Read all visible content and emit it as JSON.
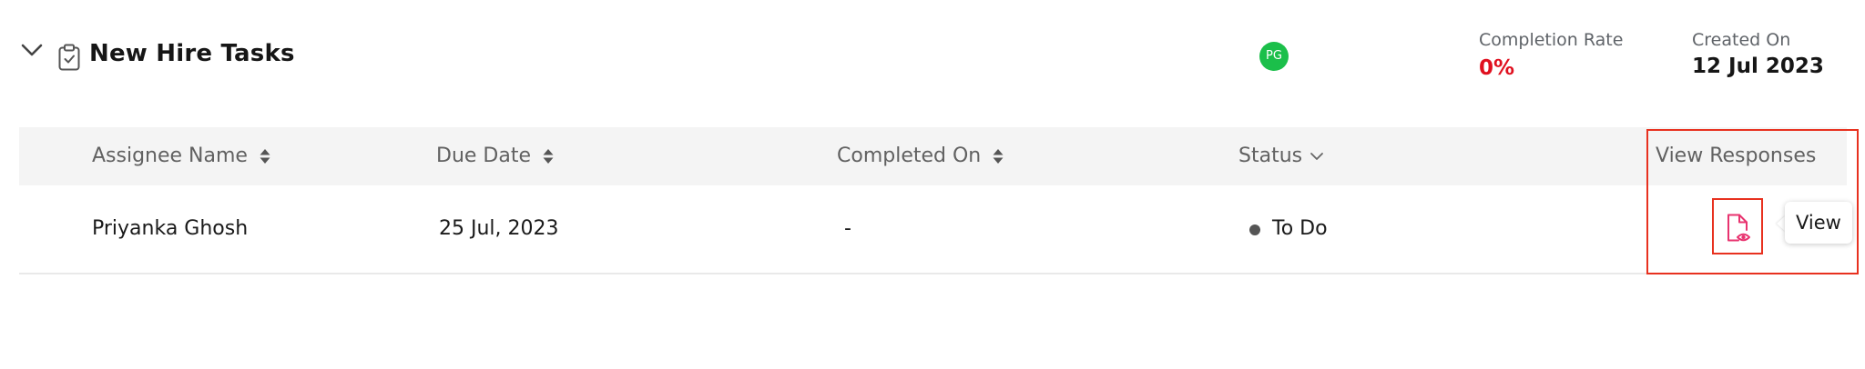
{
  "header": {
    "title": "New Hire Tasks",
    "avatar_initials": "PG",
    "avatar_color": "#1bbf4a",
    "completion_rate_label": "Completion Rate",
    "completion_rate_value": "0%",
    "completion_rate_color": "#e0101f",
    "created_on_label": "Created On",
    "created_on_value": "12 Jul 2023",
    "icons": [
      "chevron-down-icon",
      "clipboard-check-icon"
    ]
  },
  "table": {
    "columns": [
      {
        "label": "Assignee Name",
        "control": "sort"
      },
      {
        "label": "Due Date",
        "control": "sort"
      },
      {
        "label": "Completed On",
        "control": "sort"
      },
      {
        "label": "Status",
        "control": "filter"
      },
      {
        "label": "View Responses",
        "control": "none"
      }
    ],
    "rows": [
      {
        "assignee": "Priyanka Ghosh",
        "due_date": "25 Jul, 2023",
        "completed_on": "-",
        "status": "To Do",
        "view_icon": "file-eye-icon"
      }
    ]
  },
  "tooltip": {
    "text": "View"
  },
  "colors": {
    "accent": "#e8336f",
    "highlight": "#e8311f",
    "header_bg": "#f4f4f4"
  }
}
